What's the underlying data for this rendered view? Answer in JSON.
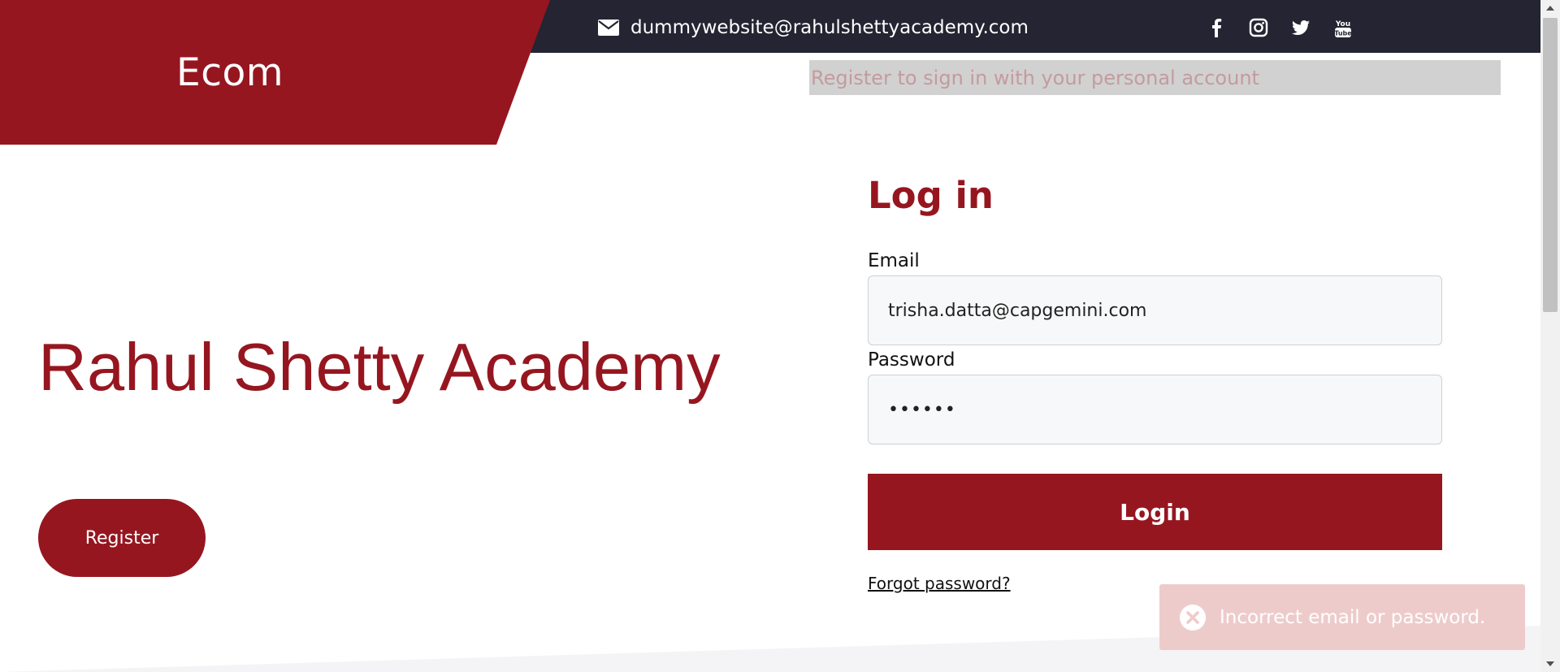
{
  "header": {
    "email": "dummywebsite@rahulshettyacademy.com",
    "social_icons": [
      "facebook-icon",
      "instagram-icon",
      "twitter-icon",
      "youtube-icon"
    ]
  },
  "brand": {
    "title": "Ecom"
  },
  "banner": {
    "text": "Register to sign in with your personal account"
  },
  "hero": {
    "title": "Rahul Shetty Academy",
    "register_label": "Register"
  },
  "login": {
    "heading": "Log in",
    "email_label": "Email",
    "email_value": "trisha.datta@capgemini.com",
    "password_label": "Password",
    "password_value": "••••••",
    "submit_label": "Login",
    "forgot_label": "Forgot password?"
  },
  "toast": {
    "message": "Incorrect email or password."
  },
  "colors": {
    "brand": "#961620",
    "topbar": "#242432",
    "toast_bg": "#eecbcb",
    "banner_bg": "#d1d1d1"
  }
}
